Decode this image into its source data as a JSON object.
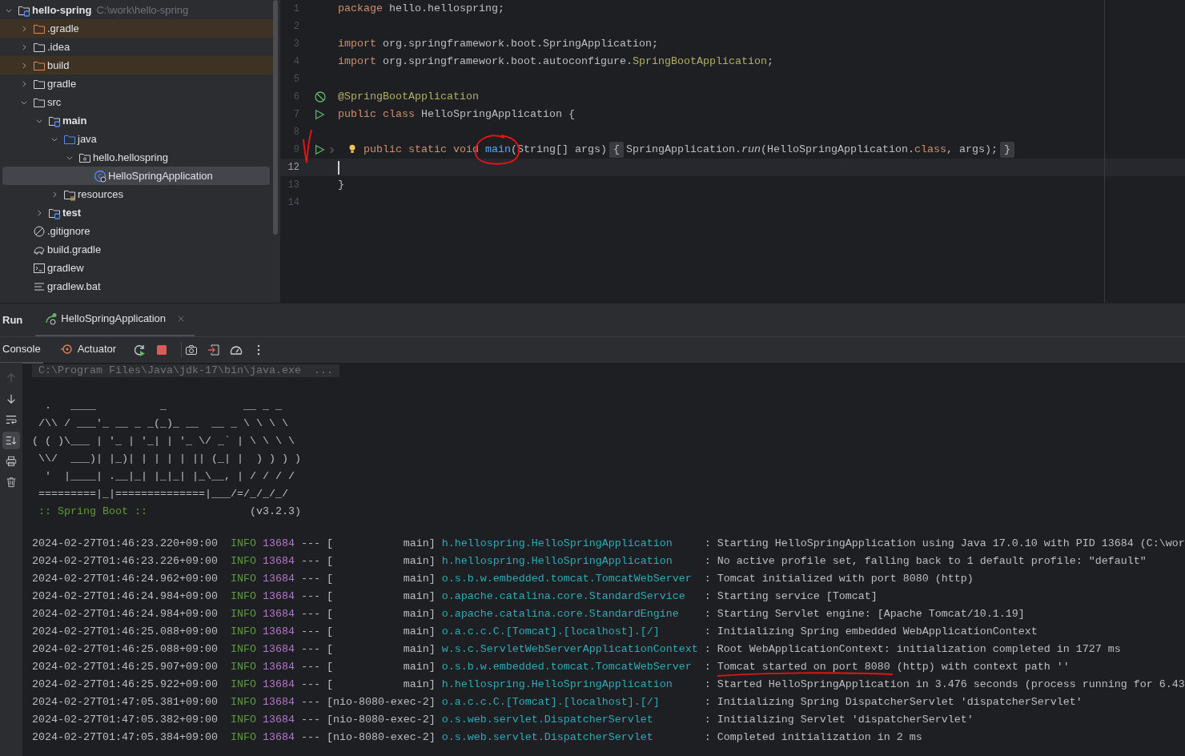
{
  "project_tree": [
    {
      "label": "hello-spring",
      "kind": "module",
      "path": "C:\\work\\hello-spring",
      "expanded": true,
      "selected": false,
      "children": [
        {
          "label": ".gradle",
          "kind": "excluded",
          "expanded": false,
          "selected": false
        },
        {
          "label": ".idea",
          "kind": "folder",
          "expanded": false,
          "selected": false
        },
        {
          "label": "build",
          "kind": "excluded",
          "expanded": false,
          "selected": false
        },
        {
          "label": "gradle",
          "kind": "folder",
          "expanded": false,
          "selected": false
        },
        {
          "label": "src",
          "kind": "folder",
          "expanded": true,
          "selected": false,
          "children": [
            {
              "label": "main",
              "kind": "module",
              "expanded": true,
              "selected": false,
              "children": [
                {
                  "label": "java",
                  "kind": "source",
                  "expanded": true,
                  "selected": false,
                  "children": [
                    {
                      "label": "hello.hellospring",
                      "kind": "package",
                      "expanded": true,
                      "selected": false,
                      "children": [
                        {
                          "label": "HelloSpringApplication",
                          "kind": "spring_class",
                          "selected": true
                        }
                      ]
                    }
                  ]
                },
                {
                  "label": "resources",
                  "kind": "resources",
                  "expanded": false,
                  "selected": false
                }
              ]
            },
            {
              "label": "test",
              "kind": "module",
              "expanded": false,
              "selected": false
            }
          ]
        },
        {
          "label": ".gitignore",
          "kind": "ignore",
          "selected": false
        },
        {
          "label": "build.gradle",
          "kind": "gradle",
          "selected": false
        },
        {
          "label": "gradlew",
          "kind": "script",
          "selected": false
        },
        {
          "label": "gradlew.bat",
          "kind": "text",
          "selected": false
        }
      ]
    }
  ],
  "editor": {
    "lines": [
      {
        "number": "1",
        "current": false,
        "tokens": [
          {
            "text": "package",
            "kind": "keyword"
          },
          {
            "text": " hello.hellospring;",
            "kind": "plain"
          }
        ]
      },
      {
        "number": "2",
        "current": false
      },
      {
        "number": "3",
        "current": false,
        "tokens": [
          {
            "text": "import",
            "kind": "keyword"
          },
          {
            "text": " org.springframework.boot.SpringApplication;",
            "kind": "plain"
          }
        ]
      },
      {
        "number": "4",
        "current": false,
        "tokens": [
          {
            "text": "import",
            "kind": "keyword"
          },
          {
            "text": " org.springframework.boot.autoconfigure.",
            "kind": "plain"
          },
          {
            "text": "SpringBootApplication",
            "kind": "annotation"
          },
          {
            "text": ";",
            "kind": "plain"
          }
        ]
      },
      {
        "number": "5",
        "current": false
      },
      {
        "number": "6",
        "current": false,
        "gutter_icons": [
          {
            "kind": "bean"
          }
        ],
        "tokens": [
          {
            "text": "@SpringBootApplication",
            "kind": "annotation"
          }
        ]
      },
      {
        "number": "7",
        "current": false,
        "gutter_icons": [
          {
            "kind": "run"
          }
        ],
        "tokens": [
          {
            "text": "public class",
            "kind": "keyword"
          },
          {
            "text": " HelloSpringApplication {",
            "kind": "plain"
          }
        ]
      },
      {
        "number": "8",
        "current": false
      },
      {
        "number": "9",
        "current": false,
        "gutter_icons": [
          {
            "kind": "run"
          },
          {
            "kind": "fold"
          }
        ],
        "bulb": true,
        "tokens": [
          {
            "text": "    public static void ",
            "kind": "keyword"
          },
          {
            "text": "main",
            "kind": "method"
          },
          {
            "text": "(String[] args)",
            "kind": "plain"
          },
          {
            "text": "{",
            "kind": "fold"
          },
          {
            "text": "SpringApplication.",
            "kind": "plain"
          },
          {
            "text": "run",
            "kind": "italic"
          },
          {
            "text": "(HelloSpringApplication.",
            "kind": "plain"
          },
          {
            "text": "class",
            "kind": "keyword"
          },
          {
            "text": ", args);",
            "kind": "plain"
          },
          {
            "text": "}",
            "kind": "fold"
          }
        ]
      },
      {
        "number": "12",
        "current": true
      },
      {
        "number": "13",
        "current": false,
        "tokens": [
          {
            "text": "}",
            "kind": "plain"
          }
        ]
      },
      {
        "number": "14",
        "current": false
      }
    ]
  },
  "run_panel": {
    "title": "Run",
    "tabs": [
      {
        "label": "HelloSpringApplication",
        "selected": true
      }
    ],
    "toolbar_tabs": [
      {
        "label": "Console",
        "kind": "console",
        "selected": true
      },
      {
        "label": "Actuator",
        "kind": "actuator",
        "selected": false
      }
    ],
    "side_tools": [
      {
        "kind": "up",
        "disabled": true,
        "on": false
      },
      {
        "kind": "down",
        "disabled": false,
        "on": false
      },
      {
        "kind": "wrap",
        "disabled": false,
        "on": false
      },
      {
        "kind": "scroll_end",
        "disabled": false,
        "on": true
      },
      {
        "kind": "print",
        "disabled": false,
        "on": false
      },
      {
        "kind": "clear",
        "disabled": false,
        "on": false
      }
    ],
    "command_line": "C:\\Program Files\\Java\\jdk-17\\bin\\java.exe  ...",
    "banner": {
      "lines": [
        "  .   ____          _            __ _ _",
        " /\\\\ / ___'_ __ _ _(_)_ __  __ _ \\ \\ \\ \\",
        "( ( )\\___ | '_ | '_| | '_ \\/ _` | \\ \\ \\ \\",
        " \\\\/  ___)| |_)| | | | | || (_| |  ) ) ) )",
        "  '  |____| .__|_| |_|_| |_\\__, | / / / /",
        " =========|_|==============|___/=/_/_/_/"
      ],
      "label": " :: Spring Boot ::",
      "version": "(v3.2.3)"
    },
    "log": [
      {
        "time": "2024-02-27T01:46:23.220+09:00",
        "level": "INFO",
        "pid": "13684",
        "sep": "---",
        "thread": "[           main]",
        "logger": "h.hellospring.HelloSpringApplication",
        "message": ": Starting HelloSpringApplication using Java 17.0.10 with PID 13684 (C:\\wor"
      },
      {
        "time": "2024-02-27T01:46:23.226+09:00",
        "level": "INFO",
        "pid": "13684",
        "sep": "---",
        "thread": "[           main]",
        "logger": "h.hellospring.HelloSpringApplication",
        "message": ": No active profile set, falling back to 1 default profile: \"default\""
      },
      {
        "time": "2024-02-27T01:46:24.962+09:00",
        "level": "INFO",
        "pid": "13684",
        "sep": "---",
        "thread": "[           main]",
        "logger": "o.s.b.w.embedded.tomcat.TomcatWebServer",
        "message": ": Tomcat initialized with port 8080 (http)"
      },
      {
        "time": "2024-02-27T01:46:24.984+09:00",
        "level": "INFO",
        "pid": "13684",
        "sep": "---",
        "thread": "[           main]",
        "logger": "o.apache.catalina.core.StandardService",
        "message": ": Starting service [Tomcat]"
      },
      {
        "time": "2024-02-27T01:46:24.984+09:00",
        "level": "INFO",
        "pid": "13684",
        "sep": "---",
        "thread": "[           main]",
        "logger": "o.apache.catalina.core.StandardEngine",
        "message": ": Starting Servlet engine: [Apache Tomcat/10.1.19]"
      },
      {
        "time": "2024-02-27T01:46:25.088+09:00",
        "level": "INFO",
        "pid": "13684",
        "sep": "---",
        "thread": "[           main]",
        "logger": "o.a.c.c.C.[Tomcat].[localhost].[/]",
        "message": ": Initializing Spring embedded WebApplicationContext"
      },
      {
        "time": "2024-02-27T01:46:25.088+09:00",
        "level": "INFO",
        "pid": "13684",
        "sep": "---",
        "thread": "[           main]",
        "logger": "w.s.c.ServletWebServerApplicationContext",
        "message": ": Root WebApplicationContext: initialization completed in 1727 ms"
      },
      {
        "time": "2024-02-27T01:46:25.907+09:00",
        "level": "INFO",
        "pid": "13684",
        "sep": "---",
        "thread": "[           main]",
        "logger": "o.s.b.w.embedded.tomcat.TomcatWebServer",
        "message": ": Tomcat started on port 8080 (http) with context path ''"
      },
      {
        "time": "2024-02-27T01:46:25.922+09:00",
        "level": "INFO",
        "pid": "13684",
        "sep": "---",
        "thread": "[           main]",
        "logger": "h.hellospring.HelloSpringApplication",
        "message": ": Started HelloSpringApplication in 3.476 seconds (process running for 6.43"
      },
      {
        "time": "2024-02-27T01:47:05.381+09:00",
        "level": "INFO",
        "pid": "13684",
        "sep": "---",
        "thread": "[nio-8080-exec-2]",
        "logger": "o.a.c.c.C.[Tomcat].[localhost].[/]",
        "message": ": Initializing Spring DispatcherServlet 'dispatcherServlet'"
      },
      {
        "time": "2024-02-27T01:47:05.382+09:00",
        "level": "INFO",
        "pid": "13684",
        "sep": "---",
        "thread": "[nio-8080-exec-2]",
        "logger": "o.s.web.servlet.DispatcherServlet",
        "message": ": Initializing Servlet 'dispatcherServlet'"
      },
      {
        "time": "2024-02-27T01:47:05.384+09:00",
        "level": "INFO",
        "pid": "13684",
        "sep": "---",
        "thread": "[nio-8080-exec-2]",
        "logger": "o.s.web.servlet.DispatcherServlet",
        "message": ": Completed initialization in 2 ms"
      }
    ]
  }
}
